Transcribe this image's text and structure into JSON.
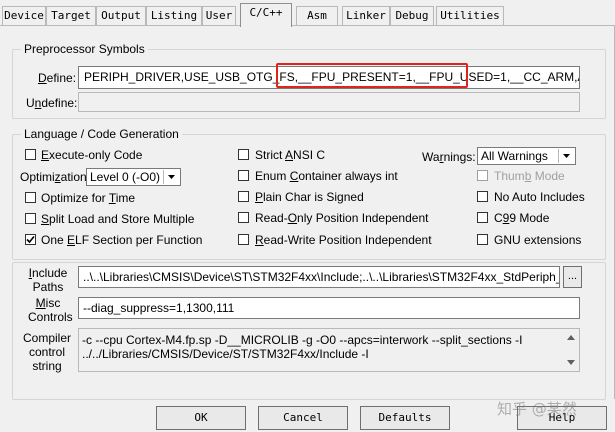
{
  "tabs": [
    "Device",
    "Target",
    "Output",
    "Listing",
    "User",
    "C/C++",
    "Asm",
    "Linker",
    "Debug",
    "Utilities"
  ],
  "preprocessor": {
    "title": "Preprocessor Symbols",
    "define_label": "Define:",
    "define_value": "PERIPH_DRIVER,USE_USB_OTG_FS,__FPU_PRESENT=1,__FPU_USED=1,__CC_ARM,ARM_MAT",
    "undefine_label": "Undefine:",
    "undefine_value": ""
  },
  "language": {
    "title": "Language / Code Generation",
    "execute_only": {
      "label": "Execute-only Code",
      "checked": false
    },
    "optimization_label": "Optimization:",
    "optimization_value": "Level 0 (-O0)",
    "optimize_time": {
      "label": "Optimize for Time",
      "checked": false
    },
    "split_load": {
      "label": "Split Load and Store Multiple",
      "checked": false
    },
    "one_elf": {
      "label": "One ELF Section per Function",
      "checked": true
    },
    "strict_ansi": {
      "label": "Strict ANSI C",
      "checked": false
    },
    "enum_container": {
      "label": "Enum Container always int",
      "checked": false
    },
    "plain_char": {
      "label": "Plain Char is Signed",
      "checked": false
    },
    "ro_pi": {
      "label": "Read-Only Position Independent",
      "checked": false
    },
    "rw_pi": {
      "label": "Read-Write Position Independent",
      "checked": false
    },
    "warnings_label": "Warnings:",
    "warnings_value": "All Warnings",
    "thumb_mode": {
      "label": "Thumb Mode",
      "checked": false,
      "disabled": true
    },
    "no_auto_includes": {
      "label": "No Auto Includes",
      "checked": false
    },
    "c99": {
      "label": "C99 Mode",
      "checked": false
    },
    "gnu_ext": {
      "label": "GNU extensions",
      "checked": false
    }
  },
  "include_paths": {
    "label_line1": "Include",
    "label_line2": "Paths",
    "value": "..\\..\\Libraries\\CMSIS\\Device\\ST\\STM32F4xx\\Include;..\\..\\Libraries\\STM32F4xx_StdPeriph_Driver\\i",
    "browse": "..."
  },
  "misc_controls": {
    "label_line1": "Misc",
    "label_line2": "Controls",
    "value": "--diag_suppress=1,1300,111"
  },
  "compiler_control": {
    "label_line1": "Compiler",
    "label_line2": "control",
    "label_line3": "string",
    "line1": "-c --cpu Cortex-M4.fp.sp -D__MICROLIB -g -O0 --apcs=interwork --split_sections -I",
    "line2": "../../Libraries/CMSIS/Device/ST/STM32F4xx/Include -I"
  },
  "buttons": {
    "ok": "OK",
    "cancel": "Cancel",
    "defaults": "Defaults",
    "help": "Help"
  },
  "watermark": "知乎 @某然",
  "colors": {
    "highlight_box": "#e0241c",
    "panel_bg": "#f0f0f0"
  }
}
